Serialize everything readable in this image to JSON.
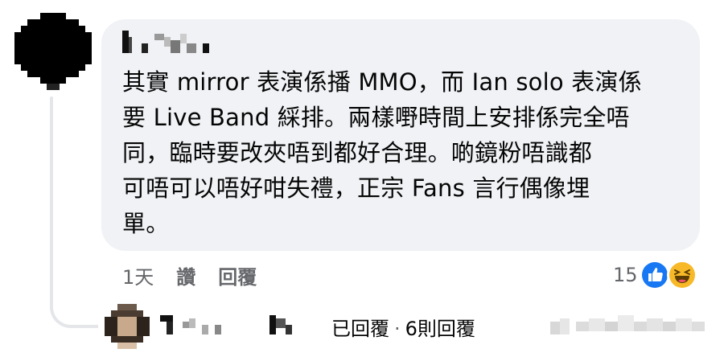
{
  "comment": {
    "lines": [
      "其實 mirror 表演係播 MMO，而 Ian solo 表演係",
      "要 Live Band 綵排。兩樣嘢時間上安排係完全唔",
      "同，臨時要改夾唔到都好合理。啲鏡粉唔識都",
      "可唔可以唔好咁失禮，正宗 Fans 言行偶像埋",
      "單。"
    ]
  },
  "actions": {
    "time": "1天",
    "like_label": "讚",
    "reply_label": "回覆"
  },
  "reactions": {
    "count": "15",
    "icons": [
      "like-icon",
      "haha-icon"
    ],
    "colors": {
      "like": "#1877f2",
      "haha": "#f7b928"
    }
  },
  "replies": {
    "label": "已回覆",
    "count_text": "6則回覆"
  },
  "colors": {
    "bubble": "#f0f2f5",
    "text": "#050505",
    "secondary": "#65676b"
  }
}
